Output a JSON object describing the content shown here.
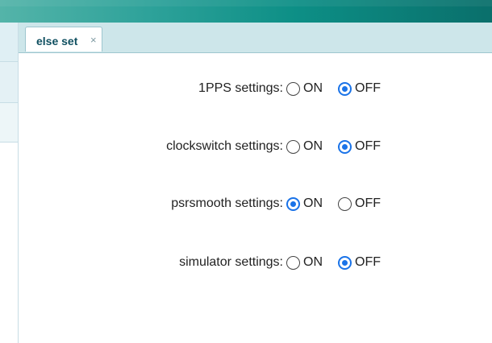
{
  "tab": {
    "label": "else set",
    "close": "×"
  },
  "settings": [
    {
      "label": "1PPS settings:",
      "on_label": "ON",
      "off_label": "OFF",
      "selected": "OFF"
    },
    {
      "label": "clockswitch settings:",
      "on_label": "ON",
      "off_label": "OFF",
      "selected": "OFF"
    },
    {
      "label": "psrsmooth settings:",
      "on_label": "ON",
      "off_label": "OFF",
      "selected": "ON"
    },
    {
      "label": "simulator settings:",
      "on_label": "ON",
      "off_label": "OFF",
      "selected": "OFF"
    }
  ],
  "colors": {
    "accent": "#1a73e8",
    "header_teal": "#0d8f86",
    "tab_text": "#0f4f60"
  }
}
